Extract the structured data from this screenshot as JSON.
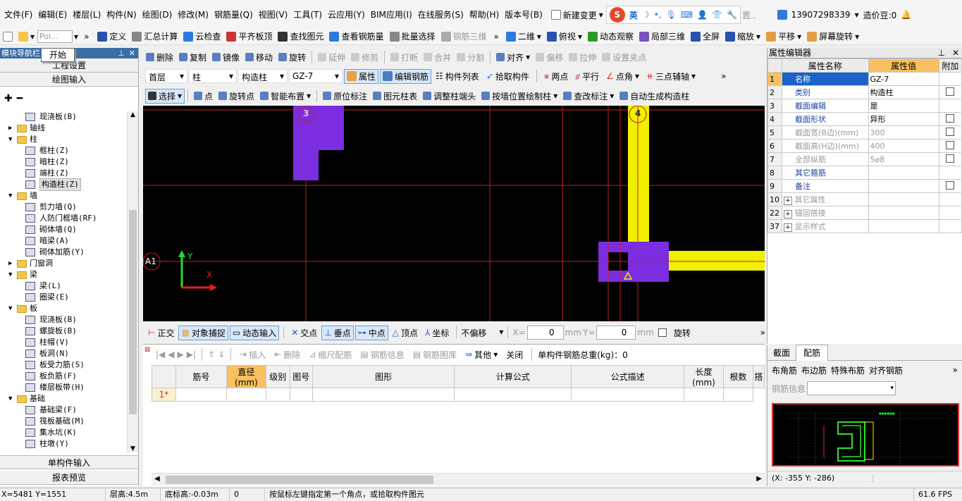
{
  "menu": [
    "文件(F)",
    "编辑(E)",
    "楼层(L)",
    "构件(N)",
    "绘图(D)",
    "修改(M)",
    "钢筋量(Q)",
    "视图(V)",
    "工具(T)",
    "云应用(Y)",
    "BIM应用(I)",
    "在线服务(S)",
    "帮助(H)",
    "版本号(B)"
  ],
  "new_change": "新建变更",
  "ime_label": "英",
  "user_phone": "13907298339",
  "price_bean": "造价豆:0",
  "toolbar1": {
    "poi": "Poi...",
    "items": [
      "定义",
      "汇总计算",
      "云检查",
      "平齐板顶",
      "查找图元",
      "查看钢筋量",
      "批量选择",
      "钢筋三维"
    ],
    "items_disabled_index": 7,
    "right": [
      "二维",
      "俯视",
      "动态观察",
      "局部三维",
      "全屏",
      "缩放",
      "平移",
      "屏幕旋转"
    ]
  },
  "tooltip": "开始",
  "left_panel": {
    "title": "模块导航栏",
    "project_settings": "工程设置",
    "drawing_input": "绘图输入",
    "single_input": "单构件输入",
    "report_preview": "报表预览",
    "tree": [
      {
        "level": 2,
        "type": "leaf",
        "label": "现浇板(B)"
      },
      {
        "level": 1,
        "type": "folder",
        "label": "轴线",
        "expanded": false
      },
      {
        "level": 1,
        "type": "folder",
        "label": "柱",
        "expanded": true
      },
      {
        "level": 2,
        "type": "leaf",
        "label": "框柱(Z)"
      },
      {
        "level": 2,
        "type": "leaf",
        "label": "暗柱(Z)"
      },
      {
        "level": 2,
        "type": "leaf",
        "label": "端柱(Z)"
      },
      {
        "level": 2,
        "type": "leaf",
        "label": "构造柱(Z)",
        "selected": true
      },
      {
        "level": 1,
        "type": "folder",
        "label": "墙",
        "expanded": true
      },
      {
        "level": 2,
        "type": "leaf",
        "label": "剪力墙(Q)"
      },
      {
        "level": 2,
        "type": "leaf",
        "label": "人防门框墙(RF)"
      },
      {
        "level": 2,
        "type": "leaf",
        "label": "砌体墙(Q)"
      },
      {
        "level": 2,
        "type": "leaf",
        "label": "暗梁(A)"
      },
      {
        "level": 2,
        "type": "leaf",
        "label": "砌体加筋(Y)"
      },
      {
        "level": 1,
        "type": "folder",
        "label": "门窗洞",
        "expanded": false
      },
      {
        "level": 1,
        "type": "folder",
        "label": "梁",
        "expanded": true
      },
      {
        "level": 2,
        "type": "leaf",
        "label": "梁(L)"
      },
      {
        "level": 2,
        "type": "leaf",
        "label": "圈梁(E)"
      },
      {
        "level": 1,
        "type": "folder",
        "label": "板",
        "expanded": true
      },
      {
        "level": 2,
        "type": "leaf",
        "label": "现浇板(B)"
      },
      {
        "level": 2,
        "type": "leaf",
        "label": "螺旋板(B)"
      },
      {
        "level": 2,
        "type": "leaf",
        "label": "柱帽(V)"
      },
      {
        "level": 2,
        "type": "leaf",
        "label": "板洞(N)"
      },
      {
        "level": 2,
        "type": "leaf",
        "label": "板受力筋(S)"
      },
      {
        "level": 2,
        "type": "leaf",
        "label": "板负筋(F)"
      },
      {
        "level": 2,
        "type": "leaf",
        "label": "楼层板带(H)"
      },
      {
        "level": 1,
        "type": "folder",
        "label": "基础",
        "expanded": true
      },
      {
        "level": 2,
        "type": "leaf",
        "label": "基础梁(F)"
      },
      {
        "level": 2,
        "type": "leaf",
        "label": "筏板基础(M)"
      },
      {
        "level": 2,
        "type": "leaf",
        "label": "集水坑(K)"
      },
      {
        "level": 2,
        "type": "leaf",
        "label": "柱墩(Y)"
      }
    ]
  },
  "edit_toolbar": [
    "删除",
    "复制",
    "镜像",
    "移动",
    "旋转",
    "延伸",
    "修剪",
    "打断",
    "合并",
    "分割",
    "对齐",
    "偏移",
    "拉伸",
    "设置夹点"
  ],
  "selectors": {
    "floor": "首层",
    "type": "柱",
    "subtype": "构造柱",
    "component": "GZ-7",
    "props_btn": "属性",
    "edit_rebar": "编辑钢筋",
    "comp_list": "构件列表",
    "pick_comp": "拾取构件",
    "two_points": "两点",
    "parallel": "平行",
    "point_angle": "点角",
    "three_point_axis": "三点辅轴"
  },
  "draw_toolbar": [
    "选择",
    "点",
    "旋转点",
    "智能布置",
    "原位标注",
    "图元柱表",
    "调整柱端头",
    "按墙位置绘制柱",
    "查改标注",
    "自动生成构造柱"
  ],
  "canvas": {
    "axis_labels": [
      "3",
      "4",
      "A1"
    ],
    "y_label": "Y",
    "x_label": "X"
  },
  "snap_bar": {
    "ortho": "正交",
    "object_snap": "对象捕捉",
    "dynamic_input": "动态输入",
    "intersection": "交点",
    "perpendicular": "垂点",
    "midpoint": "中点",
    "vertex": "顶点",
    "coordinate": "坐标",
    "offset_mode": "不偏移",
    "x_label": "X=",
    "x_value": "0",
    "y_label": "Y=",
    "y_value": "0",
    "unit": "mm",
    "rotate": "旋转"
  },
  "rebar_toolbar": {
    "insert": "插入",
    "delete": "删除",
    "scale_rebar": "缩尺配筋",
    "rebar_info": "钢筋信息",
    "rebar_lib": "钢筋图库",
    "other": "其他",
    "close": "关闭",
    "total": "单构件钢筋总重(kg)：0"
  },
  "rebar_table": {
    "headers": [
      "筋号",
      "直径(mm)",
      "级别",
      "图号",
      "图形",
      "计算公式",
      "公式描述",
      "长度(mm)",
      "根数",
      "搭"
    ],
    "rows": [
      [
        "1*",
        "",
        "",
        "",
        "",
        "",
        "",
        "",
        "",
        ""
      ]
    ]
  },
  "props_editor": {
    "title": "属性编辑器",
    "headers": [
      "属性名称",
      "属性值",
      "附加"
    ],
    "rows": [
      {
        "no": "1",
        "name": "名称",
        "value": "GZ-7",
        "gray": false,
        "check": false,
        "expand": false
      },
      {
        "no": "2",
        "name": "类别",
        "value": "构造柱",
        "gray": false,
        "check": true,
        "expand": false
      },
      {
        "no": "3",
        "name": "截面编辑",
        "value": "是",
        "gray": false,
        "check": false,
        "expand": false
      },
      {
        "no": "4",
        "name": "截面形状",
        "value": "异形",
        "gray": false,
        "check": true,
        "expand": false
      },
      {
        "no": "5",
        "name": "截面宽(B边)(mm)",
        "value": "300",
        "gray": true,
        "check": true,
        "expand": false
      },
      {
        "no": "6",
        "name": "截面高(H边)(mm)",
        "value": "400",
        "gray": true,
        "check": true,
        "expand": false
      },
      {
        "no": "7",
        "name": "全部纵筋",
        "value": "5⌀8",
        "gray": true,
        "check": true,
        "expand": false
      },
      {
        "no": "8",
        "name": "其它箍筋",
        "value": "",
        "gray": false,
        "check": false,
        "expand": false
      },
      {
        "no": "9",
        "name": "备注",
        "value": "",
        "gray": false,
        "check": true,
        "expand": false
      },
      {
        "no": "10",
        "name": "其它属性",
        "value": "",
        "gray": true,
        "check": false,
        "expand": true
      },
      {
        "no": "22",
        "name": "锚固搭接",
        "value": "",
        "gray": true,
        "check": false,
        "expand": true
      },
      {
        "no": "37",
        "name": "显示样式",
        "value": "",
        "gray": true,
        "check": false,
        "expand": true
      }
    ]
  },
  "section_tabs": [
    "截面",
    "配筋"
  ],
  "section_toolbar": [
    "布角筋",
    "布边筋",
    "特殊布筋",
    "对齐钢筋"
  ],
  "rebar_info_label": "钢筋信息",
  "preview_coords": "(X: -355 Y: -286)",
  "status": {
    "coords": "X=5481 Y=1551",
    "floor_height": "层高:4.5m",
    "bottom_elev": "底标高:-0.03m",
    "zero": "0",
    "hint": "按鼠标左键指定第一个角点，或拾取构件图元",
    "fps": "61.6 FPS"
  }
}
